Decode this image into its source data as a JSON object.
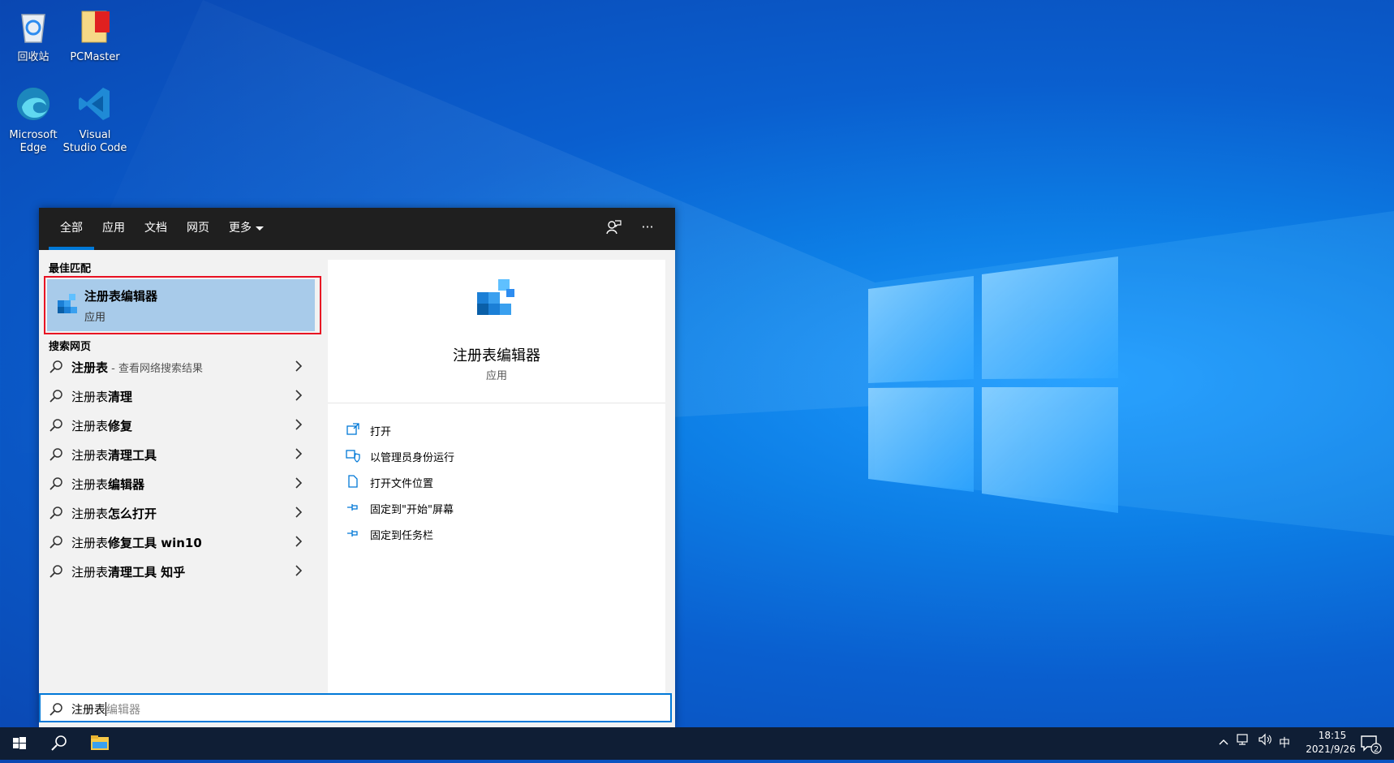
{
  "desktop": {
    "icons": [
      {
        "label": "回收站"
      },
      {
        "label": "PCMaster"
      },
      {
        "label": "Microsoft Edge"
      },
      {
        "label": "Visual Studio Code"
      }
    ]
  },
  "search_panel": {
    "tabs": [
      "全部",
      "应用",
      "文档",
      "网页",
      "更多"
    ],
    "active_tab": "全部",
    "header_icons": [
      "feedback-icon",
      "more-options-icon"
    ],
    "best_match_title": "最佳匹配",
    "best_match": {
      "name": "注册表编辑器",
      "type": "应用"
    },
    "web_title": "搜索网页",
    "web_results": [
      {
        "bold": "注册表",
        "rest": "",
        "hint": " - 查看网络搜索结果"
      },
      {
        "bold": "注册表",
        "rest": "清理",
        "hint": ""
      },
      {
        "bold": "注册表",
        "rest": "修复",
        "hint": ""
      },
      {
        "bold": "注册表",
        "rest": "清理工具",
        "hint": ""
      },
      {
        "bold": "注册表",
        "rest": "编辑器",
        "hint": ""
      },
      {
        "bold": "注册表",
        "rest": "怎么打开",
        "hint": ""
      },
      {
        "bold": "注册表",
        "rest": "修复工具 win10",
        "hint": ""
      },
      {
        "bold": "注册表",
        "rest": "清理工具 知乎",
        "hint": ""
      }
    ],
    "preview": {
      "name": "注册表编辑器",
      "type": "应用",
      "actions": [
        {
          "label": "打开",
          "icon": "open-icon"
        },
        {
          "label": "以管理员身份运行",
          "icon": "shield-icon"
        },
        {
          "label": "打开文件位置",
          "icon": "file-location-icon"
        },
        {
          "label": "固定到\"开始\"屏幕",
          "icon": "pin-icon"
        },
        {
          "label": "固定到任务栏",
          "icon": "pin-icon"
        }
      ]
    },
    "search_box": {
      "typed": "注册表",
      "suggestion": "编辑器"
    }
  },
  "taskbar": {
    "items": [
      "start-icon",
      "search-icon",
      "file-explorer-icon"
    ],
    "tray": {
      "ime": "中",
      "time": "18:15",
      "date": "2021/9/26",
      "notification_count": "2"
    }
  },
  "colors": {
    "accent": "#0078d7",
    "selection": "#a8cbea",
    "highlight_outline": "#e81123",
    "header": "#1f1f1f",
    "taskbar": "#0f1e35"
  }
}
